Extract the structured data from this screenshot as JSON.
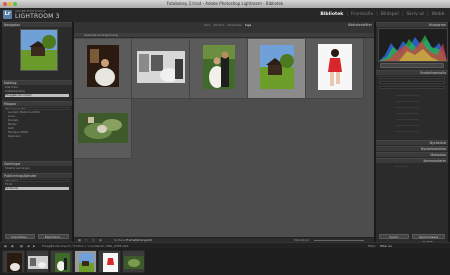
{
  "window": {
    "title": "Fotobokey 2.lrcat - Adobe Photoshop Lightroom - Bibliotek"
  },
  "identity": {
    "badge": "Lr",
    "small": "ADOBE PHOTOSHOP",
    "product": "LIGHTROOM 3"
  },
  "modules": [
    "Bibliotek",
    "Framkalla",
    "Bildspel",
    "Skriv ut",
    "Webb"
  ],
  "active_module": "Bibliotek",
  "left_panel": {
    "navigator": "Navigator",
    "catalog": "Katalog",
    "catalog_rows": [
      "Alla foton",
      "Snabbsamling",
      "Föregående import"
    ],
    "folders": "Mappar",
    "folder_rows": [
      "Macintosh HD",
      "Lunkahi Mallorca 2009",
      "Luna",
      "Daniels",
      "Model",
      "Katt",
      "Familjen 2008",
      "Robinson"
    ],
    "collections": "Samlingar",
    "collection_rows": [
      "Smarta samlingar"
    ],
    "publish": "Publiceringstjänster",
    "publish_rows": [
      "Hårddisk",
      "Flickr",
      "Facebook"
    ],
    "import_label": "Importera...",
    "export_label": "Exportera..."
  },
  "library_filter": {
    "title": "Biblioteksfilter",
    "filter_label": "Filter",
    "tabs": [
      "Text",
      "Attribut",
      "Metadata",
      "Inga"
    ],
    "active_tab": "Inga"
  },
  "grid_header": "Sparade arrangemang",
  "grid_selected_index": 3,
  "toolbar": {
    "sort_label": "Sortera:",
    "sort_value": "Framställningstid",
    "thumb_label": "Miniatyrer"
  },
  "right_panel": {
    "histogram": "Histogram",
    "quick_develop": "Snabbframkalla",
    "keywording": "Nyckelord",
    "keyword_list": "Nyckelordslista",
    "metadata": "Metadata",
    "comments": "Kommentarer",
    "sync_button": "Synkr.",
    "sync_settings_button": "Synkronisera inställn."
  },
  "filmstrip_bar": {
    "path": "Föregående import / 9 foton / 1 markerat / IMG_0785.CR2",
    "filter_label": "Filter:",
    "filter_value": "Filter av"
  },
  "filmstrip_selected_index": 3,
  "colors": {
    "active_module": "#f2f2f2",
    "inactive_module": "#7d7d7d",
    "grid_bg": "#4d4d4d",
    "selected_cell": "#8b8b8b"
  }
}
